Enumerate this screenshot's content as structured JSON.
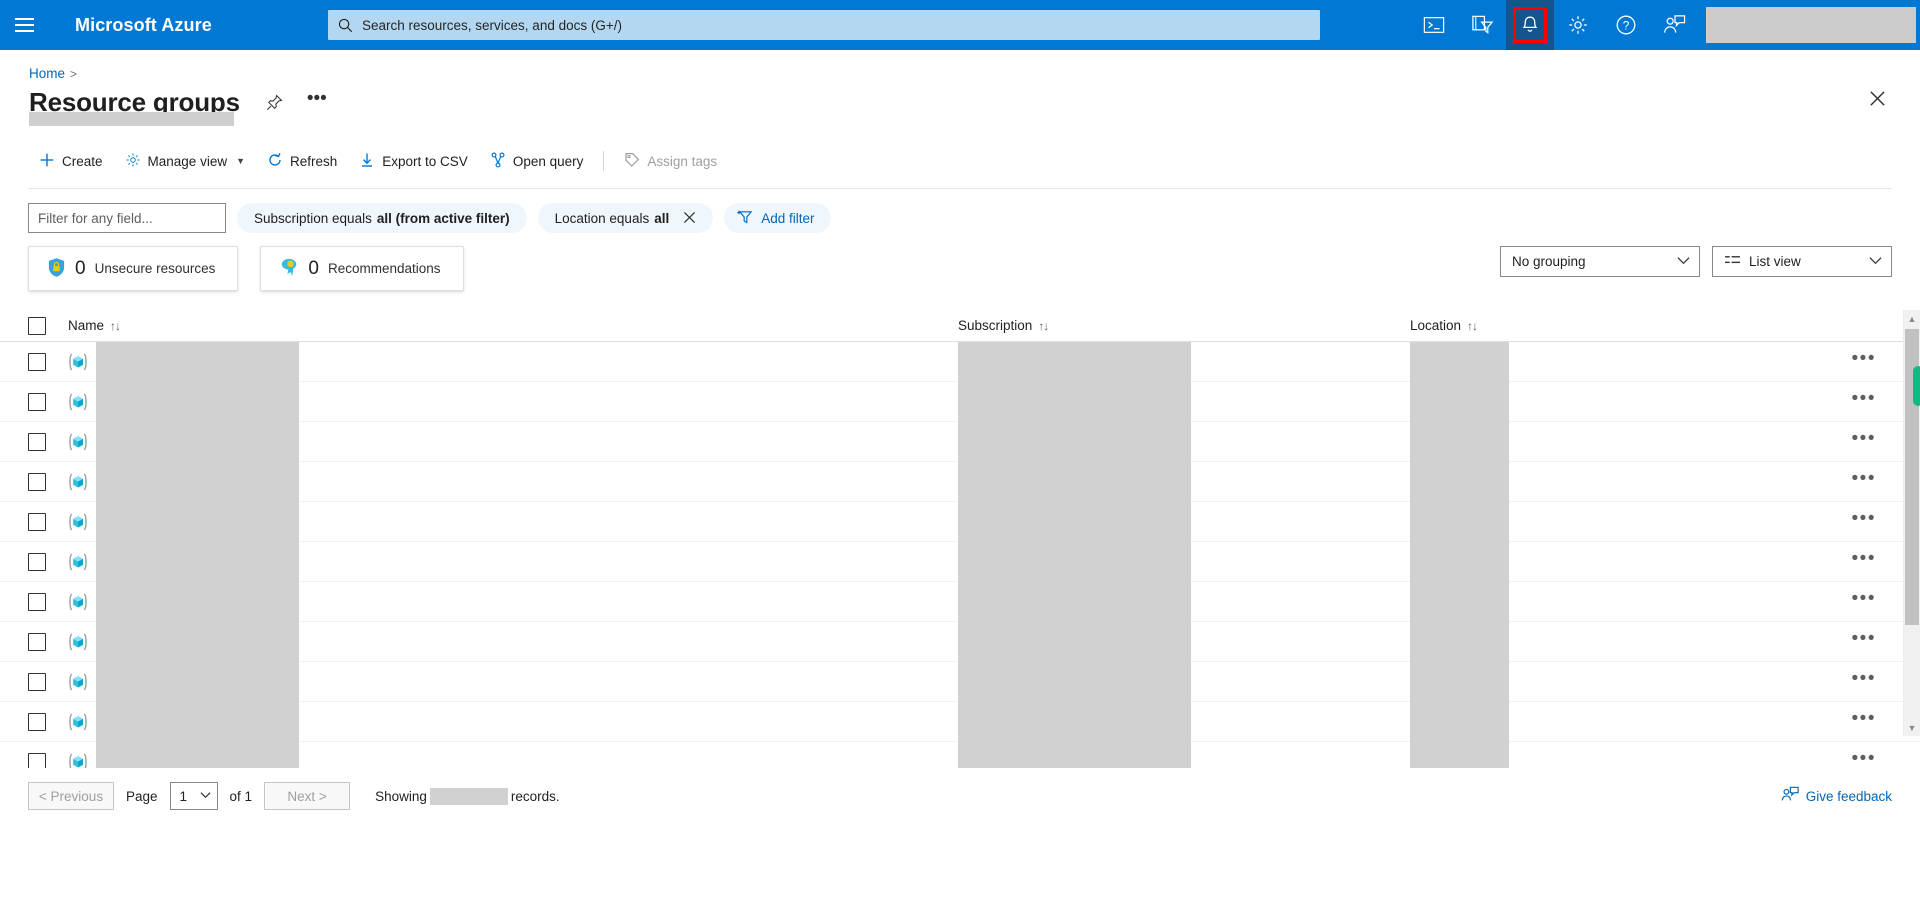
{
  "topbar": {
    "menu_icon": "hamburger-menu-icon",
    "brand": "Microsoft Azure",
    "search": {
      "icon": "search-icon",
      "placeholder": "Search resources, services, and docs (G+/)",
      "value": ""
    },
    "icons": [
      {
        "name": "cloud-shell-icon",
        "label": "Cloud Shell"
      },
      {
        "name": "directory-subscription-filter-icon",
        "label": "Directories + subscriptions"
      },
      {
        "name": "notifications-bell-icon",
        "label": "Notifications",
        "highlighted": true
      },
      {
        "name": "settings-gear-icon",
        "label": "Settings"
      },
      {
        "name": "help-question-icon",
        "label": "Help"
      },
      {
        "name": "feedback-person-icon",
        "label": "Feedback"
      }
    ],
    "account_redacted": true,
    "highlight_color": "#ff0000",
    "brand_color": "#0078d4"
  },
  "breadcrumb": {
    "items": [
      "Home"
    ],
    "separator": ">"
  },
  "page": {
    "title": "Resource groups",
    "pin_icon": "pin-icon",
    "more_icon": "ellipsis-icon",
    "close_icon": "close-icon",
    "subtitle_redacted": true
  },
  "commandbar": [
    {
      "label": "Create",
      "icon": "plus-icon",
      "disabled": false,
      "chevron": false
    },
    {
      "label": "Manage view",
      "icon": "gear-icon",
      "disabled": false,
      "chevron": true
    },
    {
      "label": "Refresh",
      "icon": "refresh-icon",
      "disabled": false,
      "chevron": false
    },
    {
      "label": "Export to CSV",
      "icon": "download-arrow-icon",
      "disabled": false,
      "chevron": false
    },
    {
      "label": "Open query",
      "icon": "query-graph-icon",
      "disabled": false,
      "chevron": false
    },
    {
      "label": "Assign tags",
      "icon": "tag-icon",
      "disabled": true,
      "chevron": false
    }
  ],
  "filters": {
    "search_placeholder": "Filter for any field...",
    "search_value": "",
    "pills": [
      {
        "prefix": "Subscription equals ",
        "value": "all (from active filter)",
        "closable": false
      },
      {
        "prefix": "Location equals ",
        "value": "all",
        "closable": true
      }
    ],
    "add_filter_label": "Add filter",
    "add_filter_icon": "add-filter-icon"
  },
  "insights": [
    {
      "icon": "shield-lock-icon",
      "count": "0",
      "label": "Unsecure resources"
    },
    {
      "icon": "advisor-recommendation-icon",
      "count": "0",
      "label": "Recommendations"
    }
  ],
  "view_controls": {
    "grouping": {
      "value": "No grouping",
      "chevron_icon": "chevron-down-icon"
    },
    "view": {
      "value": "List view",
      "icon": "list-view-icon",
      "chevron_icon": "chevron-down-icon"
    }
  },
  "table": {
    "columns": [
      {
        "label": "Name",
        "sort_icon": "sort-updown-icon"
      },
      {
        "label": "Subscription",
        "sort_icon": "sort-updown-icon"
      },
      {
        "label": "Location",
        "sort_icon": "sort-updown-icon"
      }
    ],
    "select_all_checkbox": false,
    "row_icon": "resource-group-icon",
    "row_menu_icon": "ellipsis-icon",
    "row_count": 11,
    "rows_redacted": true,
    "scrollbar": {
      "up_arrow_icon": "chevron-up-icon",
      "down_arrow_icon": "chevron-down-icon",
      "accent_color": "#13b982"
    }
  },
  "footer": {
    "previous_label": "< Previous",
    "previous_disabled": true,
    "page_label": "Page",
    "page_value": "1",
    "of_label": "of 1",
    "next_label": "Next >",
    "next_disabled": true,
    "showing_prefix": "Showing",
    "showing_count_redacted": true,
    "showing_suffix": "records.",
    "give_feedback_label": "Give feedback",
    "give_feedback_icon": "feedback-person-icon"
  }
}
